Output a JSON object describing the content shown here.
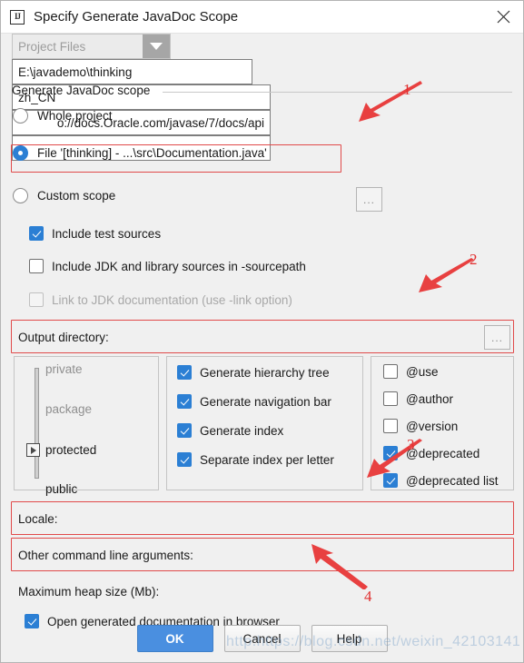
{
  "window": {
    "title": "Specify Generate JavaDoc Scope",
    "app_icon": "intellij-idea-icon",
    "close_icon": "close-icon"
  },
  "scope_group": {
    "legend": "Generate JavaDoc scope",
    "options": [
      {
        "label": "Whole project",
        "mnemonic": "p",
        "checked": false
      },
      {
        "label": "File '[thinking] - ...\\src\\Documentation.java'",
        "mnemonic": "F",
        "checked": true
      },
      {
        "label": "Custom scope",
        "mnemonic": "C",
        "checked": false
      }
    ],
    "custom_scope_value": "Project Files",
    "custom_scope_browse": "...",
    "dropdown_icon": "chevron-down-icon"
  },
  "source_checkboxes": [
    {
      "label": "Include test sources",
      "checked": true,
      "disabled": false
    },
    {
      "label": "Include JDK and library sources in -sourcepath",
      "checked": false,
      "disabled": false
    },
    {
      "label": "Link to JDK documentation (use -link option)",
      "checked": false,
      "disabled": true
    }
  ],
  "output": {
    "label": "Output directory:",
    "value": "E:\\javademo\\thinking",
    "browse": "...",
    "browse_icon": "ellipsis-icon"
  },
  "visibility": {
    "levels": [
      "private",
      "package",
      "protected",
      "public"
    ],
    "selected": "protected",
    "slider_icon": "slider-thumb-icon"
  },
  "generate_options": [
    {
      "label": "Generate hierarchy tree",
      "checked": true
    },
    {
      "label": "Generate navigation bar",
      "checked": true
    },
    {
      "label": "Generate index",
      "checked": true
    },
    {
      "label": "Separate index per letter",
      "checked": true
    }
  ],
  "tag_options": [
    {
      "label": "@use",
      "checked": false
    },
    {
      "label": "@author",
      "checked": false
    },
    {
      "label": "@version",
      "checked": false
    },
    {
      "label": "@deprecated",
      "checked": true
    },
    {
      "label": "@deprecated list",
      "checked": true
    }
  ],
  "locale": {
    "label": "Locale:",
    "value": "zh_CN"
  },
  "cmdline": {
    "label": "Other command line arguments:",
    "value": "o://docs.Oracle.com/javase/7/docs/api"
  },
  "heap": {
    "label": "Maximum heap size (Mb):",
    "value": ""
  },
  "open_browser": {
    "label": "Open generated documentation in browser",
    "checked": true
  },
  "buttons": {
    "ok": "OK",
    "cancel": "Cancel",
    "help": "Help"
  },
  "annotations": {
    "numbers": [
      "1",
      "2",
      "3",
      "4"
    ],
    "color": "#e03030"
  },
  "watermark": "http:https://blog.csdn.net/weixin_42103141"
}
